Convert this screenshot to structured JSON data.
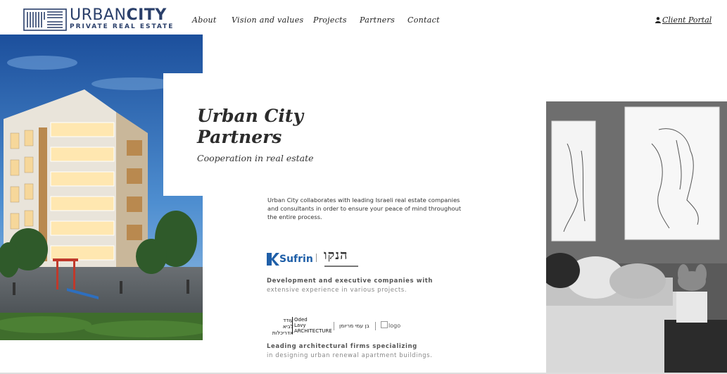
{
  "brand": {
    "name_light": "URBAN",
    "name_bold": "CITY",
    "tagline": "PRIVATE REAL ESTATE",
    "primary_color": "#2a3f6a"
  },
  "nav": {
    "items": [
      {
        "label": "About"
      },
      {
        "label": "Vision and values"
      },
      {
        "label": "Projects"
      },
      {
        "label": "Partners"
      },
      {
        "label": "Contact"
      }
    ],
    "portal_label": "Client Portal",
    "portal_icon": "user-icon"
  },
  "hero": {
    "title_line1": "Urban City",
    "title_line2": "Partners",
    "subtitle": "Cooperation in real estate",
    "intro": "Urban City collaborates with leading Israeli real estate companies and consultants in order to ensure your peace of mind throughout the entire process."
  },
  "development": {
    "logo_sufrin": "Sufrin",
    "logo_hanko": "הנקו",
    "text_line1": "Development and executive companies with",
    "text_line2": "extensive experience in various projects."
  },
  "architecture": {
    "oded_heb_1": "עודד",
    "oded_heb_2": "לביא",
    "oded_heb_3": "אדריכלות",
    "oded_eng_1": "Oded",
    "oded_eng_2": "Lavy",
    "oded_eng_3": "ARCHITECTURE",
    "ben_label": "בן עמי מריומן",
    "broken_logo_alt": "logo",
    "text_line1": "Leading architectural firms specializing",
    "text_line2": "in designing urban renewal apartment buildings."
  }
}
